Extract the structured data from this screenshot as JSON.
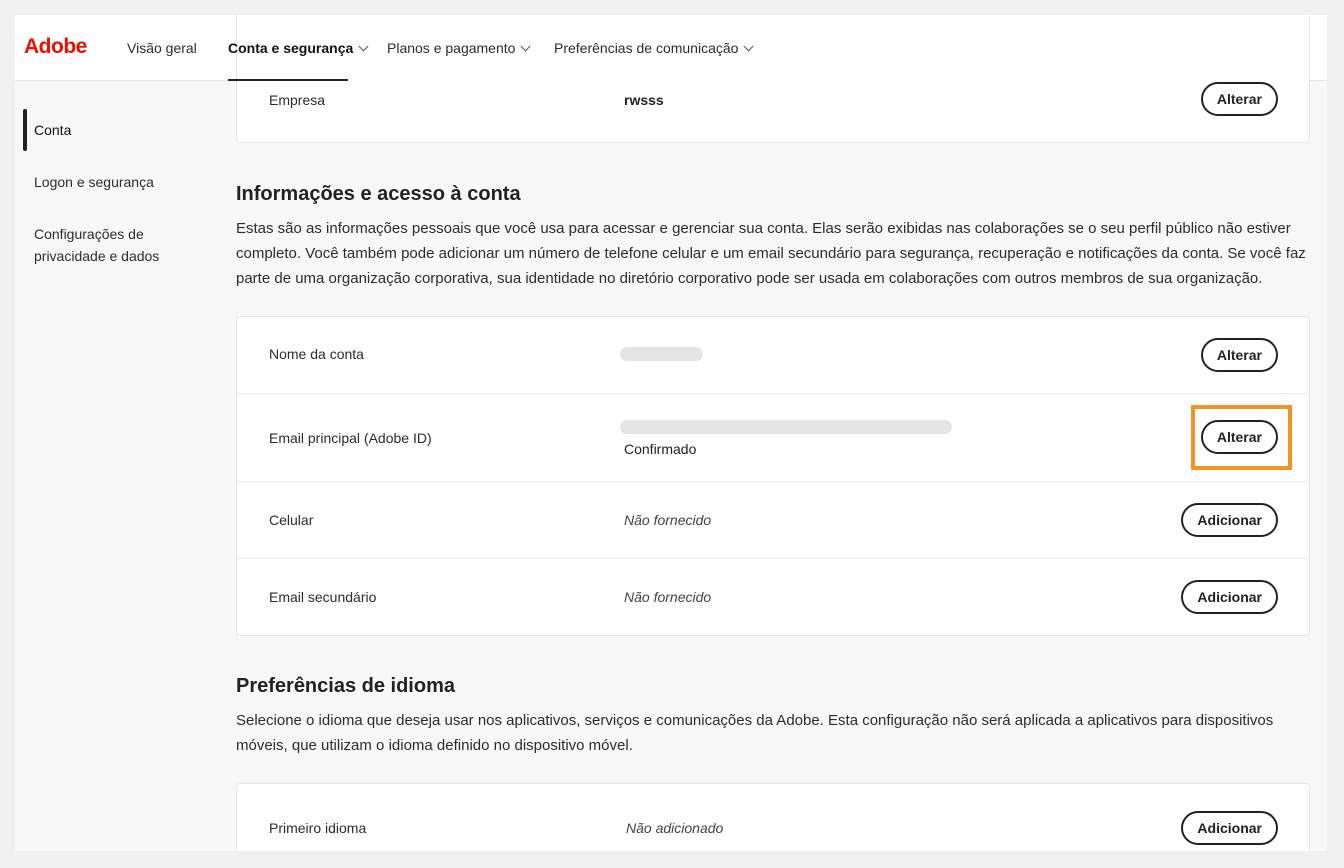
{
  "header": {
    "logo": "Adobe",
    "nav": [
      {
        "label": "Visão geral"
      },
      {
        "label": "Conta e segurança"
      },
      {
        "label": "Planos e pagamento"
      },
      {
        "label": "Preferências de comunicação"
      }
    ]
  },
  "sidebar": {
    "items": [
      {
        "label": "Conta"
      },
      {
        "label": "Logon e segurança"
      },
      {
        "label": "Configurações de privacidade e dados"
      }
    ]
  },
  "company": {
    "label": "Empresa",
    "value": "rwsss",
    "button": "Alterar"
  },
  "account": {
    "title": "Informações e acesso à conta",
    "description": "Estas são as informações pessoais que você usa para acessar e gerenciar sua conta. Elas serão exibidas nas colaborações se o seu perfil público não estiver completo. Você também pode adicionar um número de telefone celular e um email secundário para segurança, recuperação e notificações da conta. Se você faz parte de uma organização corporativa, sua identidade no diretório corporativo pode ser usada em colaborações com outros membros de sua organização.",
    "rows": [
      {
        "label": "Nome da conta",
        "button": "Alterar"
      },
      {
        "label": "Email principal (Adobe ID)",
        "status": "Confirmado",
        "button": "Alterar"
      },
      {
        "label": "Celular",
        "value": "Não fornecido",
        "button": "Adicionar"
      },
      {
        "label": "Email secundário",
        "value": "Não fornecido",
        "button": "Adicionar"
      }
    ]
  },
  "language": {
    "title": "Preferências de idioma",
    "description": "Selecione o idioma que deseja usar nos aplicativos, serviços e comunicações da Adobe. Esta configuração não será aplicada a aplicativos para dispositivos móveis, que utilizam o idioma definido no dispositivo móvel.",
    "rows": [
      {
        "label": "Primeiro idioma",
        "value": "Não adicionado",
        "button": "Adicionar"
      }
    ]
  }
}
